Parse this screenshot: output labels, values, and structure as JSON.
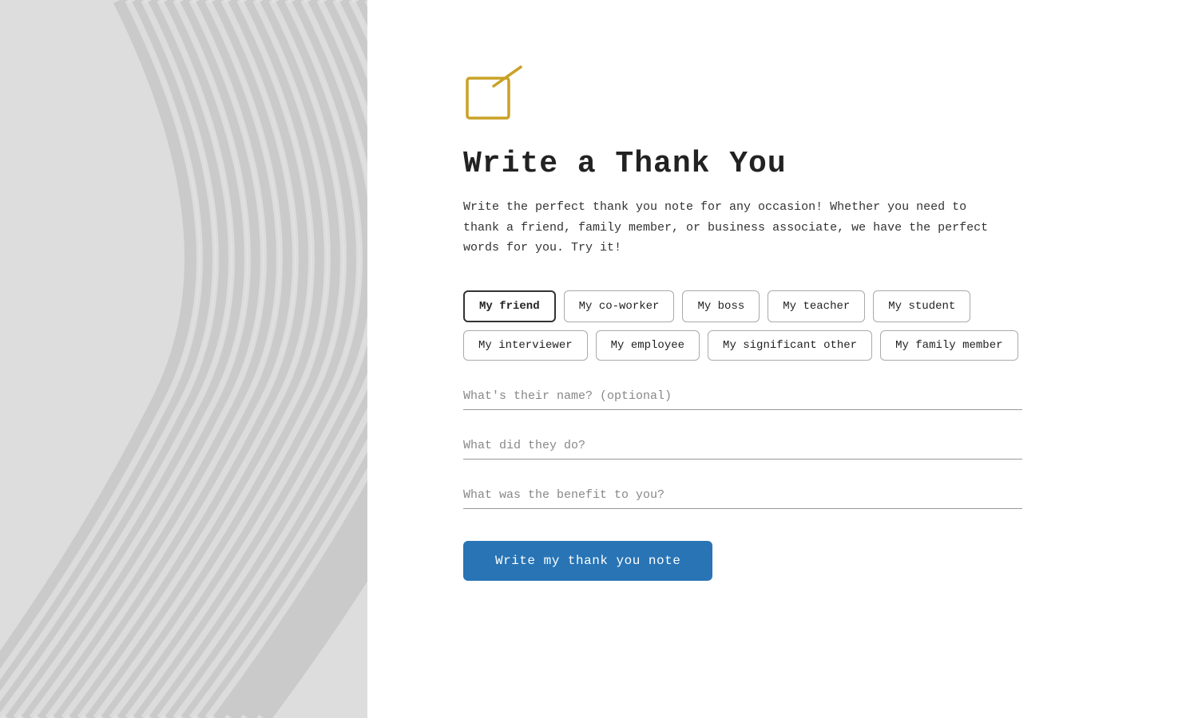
{
  "left_panel": {
    "aria_label": "decorative wave background"
  },
  "right_panel": {
    "icon": {
      "label": "write-note-icon",
      "color": "#c9a227"
    },
    "title": "Write a Thank You",
    "description": "Write the perfect thank you note for any occasion! Whether you need to thank a friend, family member, or business associate, we have the perfect words for you. Try it!",
    "recipient_buttons": [
      {
        "id": "friend",
        "label": "My friend",
        "selected": true
      },
      {
        "id": "coworker",
        "label": "My co-worker",
        "selected": false
      },
      {
        "id": "boss",
        "label": "My boss",
        "selected": false
      },
      {
        "id": "teacher",
        "label": "My teacher",
        "selected": false
      },
      {
        "id": "student",
        "label": "My student",
        "selected": false
      },
      {
        "id": "interviewer",
        "label": "My interviewer",
        "selected": false
      },
      {
        "id": "employee",
        "label": "My employee",
        "selected": false
      },
      {
        "id": "significant_other",
        "label": "My significant other",
        "selected": false
      },
      {
        "id": "family_member",
        "label": "My family member",
        "selected": false
      }
    ],
    "fields": [
      {
        "id": "name",
        "placeholder": "What's their name? (optional)"
      },
      {
        "id": "what_did",
        "placeholder": "What did they do?"
      },
      {
        "id": "benefit",
        "placeholder": "What was the benefit to you?"
      }
    ],
    "submit_button": "Write my thank you note"
  }
}
